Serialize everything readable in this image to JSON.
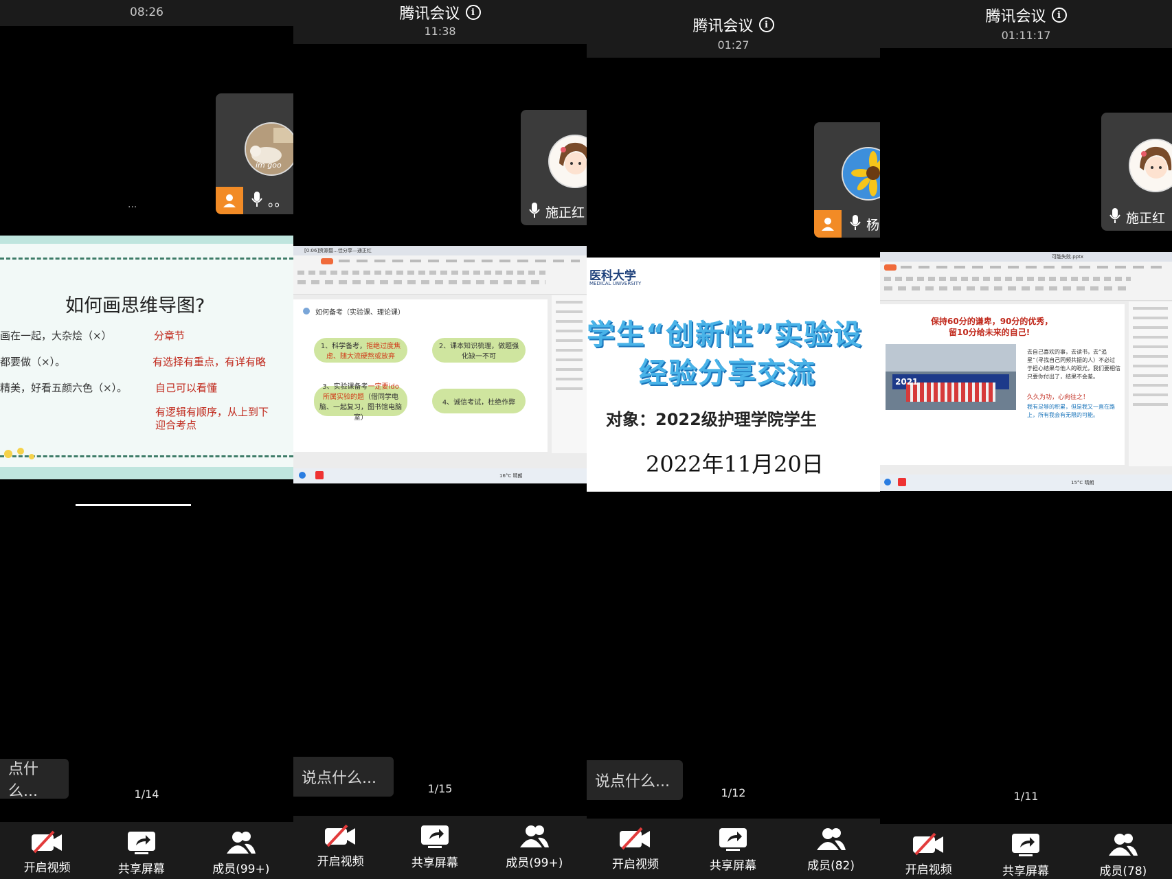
{
  "common": {
    "app_title": "腾讯会议",
    "chat_placeholder": "说点什么...",
    "btn_video": "开启视频",
    "btn_share": "共享屏幕"
  },
  "panel1": {
    "time": "08:26",
    "chat_text": "点什么...",
    "page": "1/14",
    "members": "成员(99+)",
    "tile_name": "。。",
    "tile_overlay": "im goo",
    "ellipsis": "...",
    "slide": {
      "title": "如何画思维导图?",
      "left": [
        "画在一起，大杂烩（×）",
        "都要做（×）。",
        "精美，好看五颜六色（×）。"
      ],
      "right": [
        "分章节",
        "有选择有重点，有详有略",
        "自己可以看懂",
        "有逻辑有顺序，从上到下\n迎合考点"
      ]
    }
  },
  "panel2": {
    "time": "11:38",
    "page": "1/15",
    "members": "成员(99+)",
    "tile_name": "施正红",
    "slide": {
      "heading": "如何备考（实验课、理论课）",
      "clouds": [
        {
          "a": "1、科学备考，",
          "b": "拒绝过度焦虑、随大流硬熬或放弃"
        },
        {
          "a": "2、课本知识梳理，做题强化缺一不可",
          "b": ""
        },
        {
          "a": "3、实验课备考",
          "b": "一定要ido所属实验的题",
          "c": "（借同学电脑、一起复习，图书馆电脑室）"
        },
        {
          "a": "4、诚信考试，杜绝作弊",
          "b": ""
        }
      ],
      "tab_label": "[0:06]资源暨...佳分享—通正红",
      "status": "16°C 晴朗"
    }
  },
  "panel3": {
    "time": "01:27",
    "page": "1/12",
    "members": "成员(82)",
    "tile_name": "杨",
    "slide": {
      "logo_cn": "医科大学",
      "logo_en": "MEDICAL UNIVERSITY",
      "line1": "学生“创新性”实验设",
      "line2": "经验分享交流",
      "line3": "对象：2022级护理学院学生",
      "line4": "2022年11月20日"
    }
  },
  "panel4": {
    "time": "01:11:17",
    "page": "1/11",
    "members": "成员(78)",
    "tile_name": "施正红",
    "slide": {
      "headline1": "保持60分的谦卑，90分的优秀，",
      "headline2": "留10分给未来的自己!",
      "para1": "去自己喜欢的事，去读书，去“追星”（寻找自己同频共振的人）不必过于担心结果与他人的眼光，我们要相信只要你付出了，结果不会差。",
      "para2": "久久为功，心向往之！",
      "para3": "我有足够的积累，但是我又一直在路上，所有我会有无限的可能。",
      "photo_text": "2021",
      "tab_label": "可能失败.pptx",
      "status": "15°C 晴朗"
    }
  },
  "colors": {
    "host_orange": "#f28b26",
    "slide_red": "#c0281b",
    "slide_blue": "#1b75bb",
    "cloud_green": "#cfe59f"
  }
}
